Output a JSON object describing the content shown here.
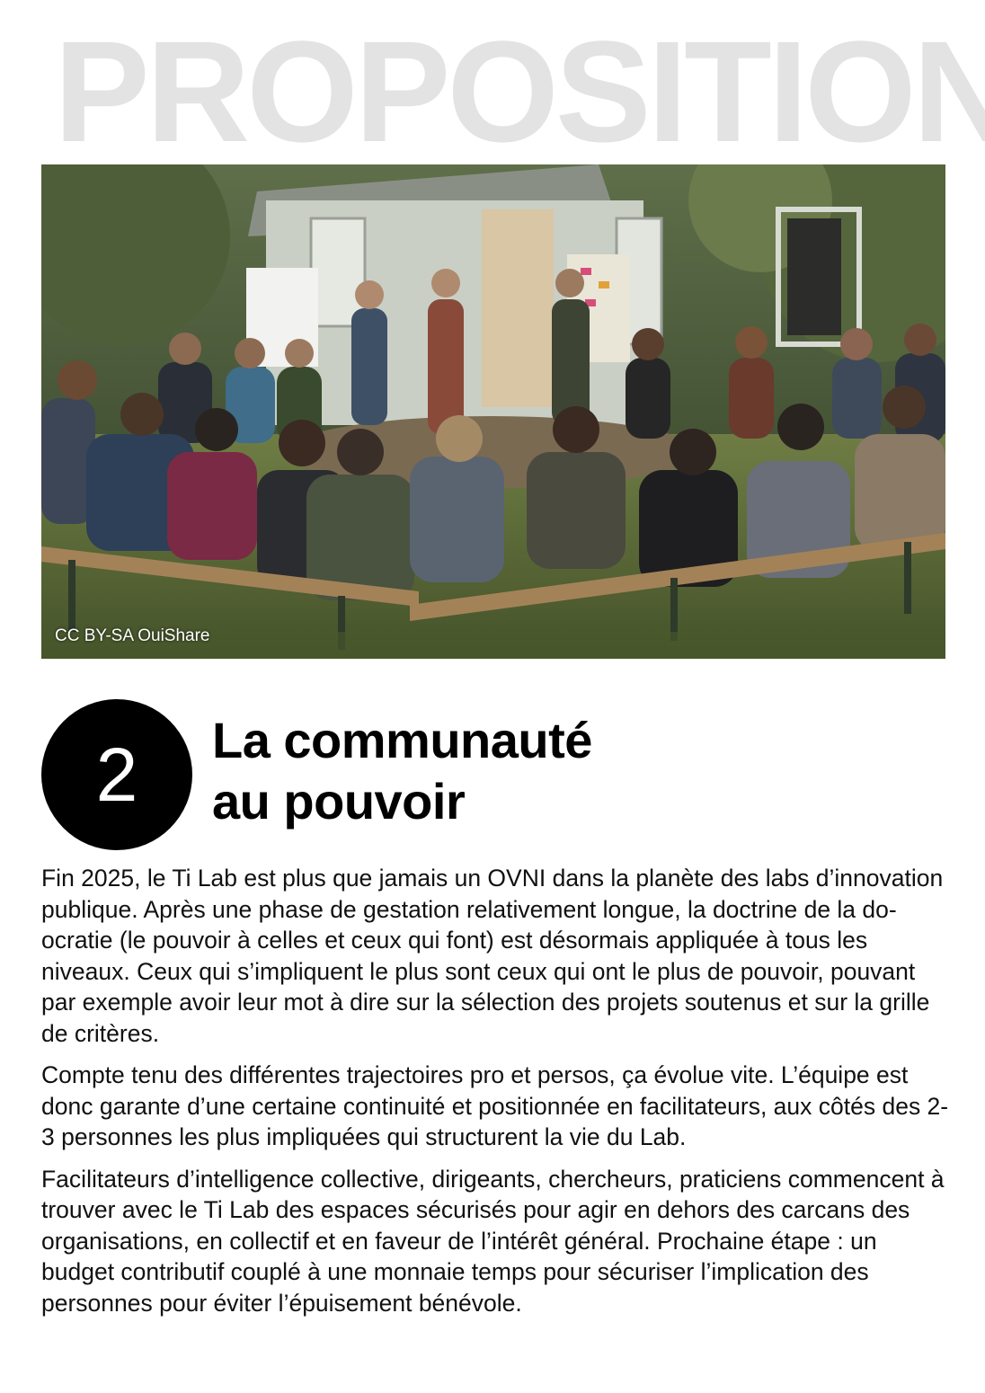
{
  "header": {
    "watermark_title": "PROPOSITION"
  },
  "photo": {
    "credit": "CC BY-SA OuiShare"
  },
  "section": {
    "number": "2",
    "title_line1": "La communauté",
    "title_line2": "au pouvoir"
  },
  "paragraphs": [
    "Fin 2025, le Ti Lab est plus que jamais un OVNI dans la planète des labs d’innovation publique. Après une phase de gestation relativement longue, la doctrine de la do-ocratie (le pouvoir à celles et ceux qui font) est désormais appliquée à tous les niveaux. Ceux qui s’impliquent le plus sont ceux qui ont le plus de pouvoir, pouvant par exemple avoir leur mot à dire sur la sélection des projets soutenus et sur la grille de critères.",
    "Compte tenu des différentes trajectoires pro et persos, ça évolue vite. L’équipe est donc garante d’une certaine continuité et positionnée en facilitateurs, aux côtés des 2-3 personnes les plus impliquées qui structurent la vie du Lab.",
    "Facilitateurs d’intelligence collective, dirigeants, chercheurs, praticiens commencent à trouver avec le Ti Lab des espaces sécurisés pour agir en dehors des carcans des organisations, en collectif et en faveur de l’intérêt général. Prochaine étape : un budget contributif couplé à une monnaie temps pour sécuriser l’implication des personnes pour éviter l’épuisement bénévole."
  ]
}
